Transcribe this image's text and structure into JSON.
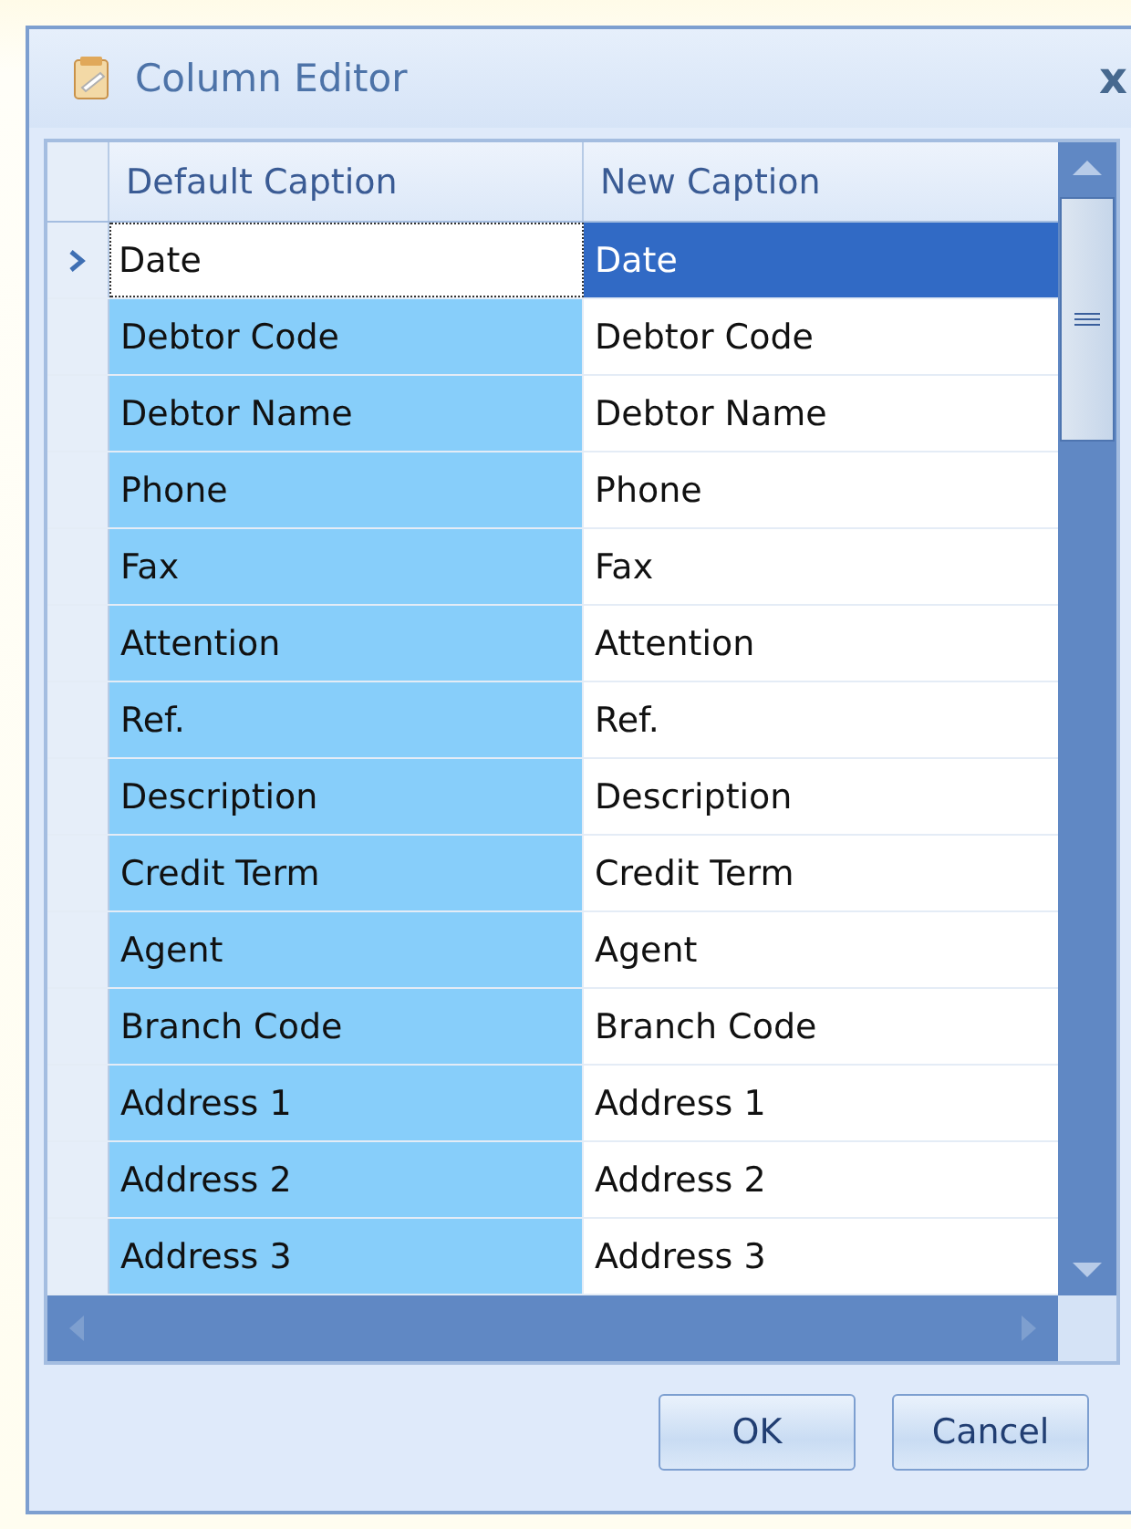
{
  "window": {
    "title": "Column Editor",
    "close": "x"
  },
  "table": {
    "columns": [
      "Default Caption",
      "New Caption"
    ],
    "rows": [
      {
        "default": "Date",
        "new": "Date",
        "selected": true
      },
      {
        "default": "Debtor Code",
        "new": "Debtor Code",
        "selected": false
      },
      {
        "default": "Debtor Name",
        "new": "Debtor Name",
        "selected": false
      },
      {
        "default": "Phone",
        "new": "Phone",
        "selected": false
      },
      {
        "default": "Fax",
        "new": "Fax",
        "selected": false
      },
      {
        "default": "Attention",
        "new": "Attention",
        "selected": false
      },
      {
        "default": "Ref.",
        "new": "Ref.",
        "selected": false
      },
      {
        "default": "Description",
        "new": "Description",
        "selected": false
      },
      {
        "default": "Credit Term",
        "new": "Credit Term",
        "selected": false
      },
      {
        "default": "Agent",
        "new": "Agent",
        "selected": false
      },
      {
        "default": "Branch Code",
        "new": "Branch Code",
        "selected": false
      },
      {
        "default": "Address 1",
        "new": "Address 1",
        "selected": false
      },
      {
        "default": "Address 2",
        "new": "Address 2",
        "selected": false
      },
      {
        "default": "Address 3",
        "new": "Address 3",
        "selected": false
      }
    ]
  },
  "buttons": [
    "OK",
    "Cancel"
  ]
}
